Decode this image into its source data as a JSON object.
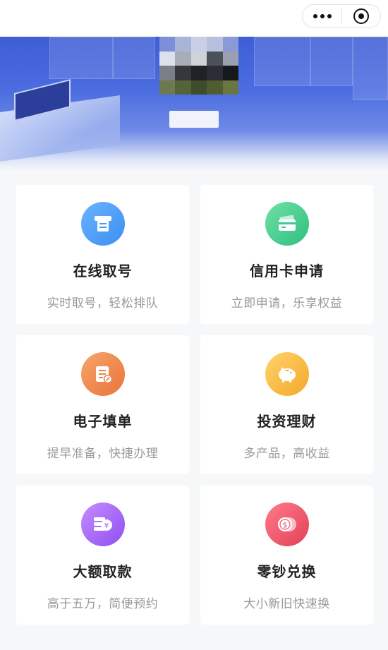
{
  "header": {
    "more_icon": "ellipsis-icon",
    "close_icon": "miniprogram-close-icon"
  },
  "banner": {
    "description_colors": {
      "primary": "#3f5ed6",
      "light": "#dfe6f8"
    }
  },
  "services": [
    {
      "key": "online-queue",
      "title": "在线取号",
      "subtitle": "实时取号，轻松排队",
      "icon": "ticket-machine-icon",
      "color_from": "#6ab3ff",
      "color_to": "#3b8ff3"
    },
    {
      "key": "credit-card",
      "title": "信用卡申请",
      "subtitle": "立即申请，乐享权益",
      "icon": "credit-card-icon",
      "color_from": "#6fe0a8",
      "color_to": "#2fbf7f"
    },
    {
      "key": "e-form",
      "title": "电子填单",
      "subtitle": "提早准备，快捷办理",
      "icon": "form-edit-icon",
      "color_from": "#f7a56b",
      "color_to": "#e9743a"
    },
    {
      "key": "investment",
      "title": "投资理财",
      "subtitle": "多产品，高收益",
      "icon": "piggy-bank-icon",
      "color_from": "#ffd36a",
      "color_to": "#f4a829"
    },
    {
      "key": "large-withdrawal",
      "title": "大额取款",
      "subtitle": "高于五万，简便预约",
      "icon": "cash-stack-icon",
      "color_from": "#c58cff",
      "color_to": "#8f4ff0"
    },
    {
      "key": "change-exchange",
      "title": "零钞兑换",
      "subtitle": "大小新旧快速换",
      "icon": "coin-exchange-icon",
      "color_from": "#ff7b8a",
      "color_to": "#e34157"
    }
  ]
}
